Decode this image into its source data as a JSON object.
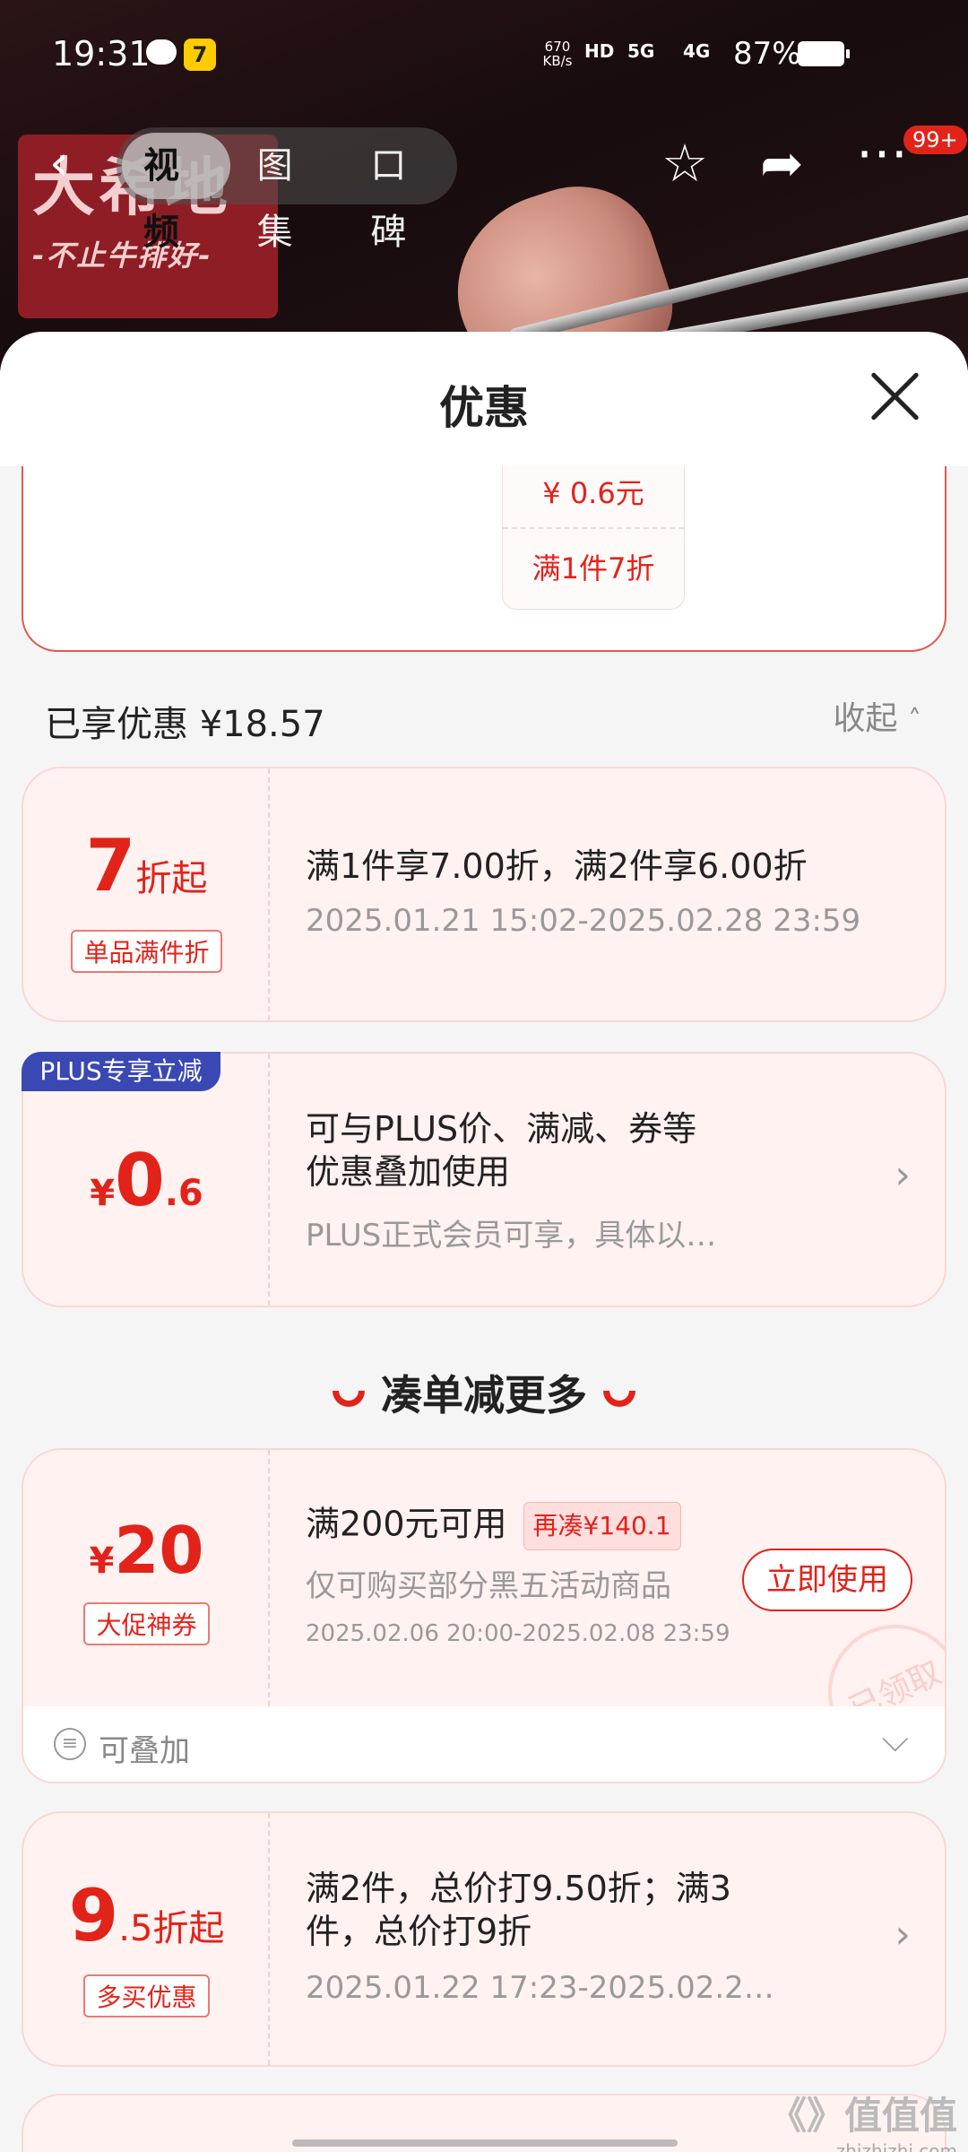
{
  "status_bar": {
    "time": "19:31",
    "app_badge": "7",
    "net_speed": "670",
    "net_unit": "KB/s",
    "hd": "HD",
    "sig1": "5G",
    "sig2": "4G",
    "battery": "87%"
  },
  "nav": {
    "tabs": [
      "视频",
      "图集",
      "口碑"
    ],
    "active_tab": "视频",
    "badge": "99+"
  },
  "background": {
    "logo_big": "大希地",
    "logo_small": "-不止牛排好-"
  },
  "sheet": {
    "title": "优惠",
    "top_card": {
      "price": "¥ 0.6元",
      "rule": "满1件7折"
    },
    "summary": "已享优惠 ¥18.57",
    "collapse_label": "收起"
  },
  "coupons": [
    {
      "value_main": "7",
      "value_suffix": "折起",
      "tag": "单品满件折",
      "title": "满1件享7.00折，满2件享6.00折",
      "sub": "2025.01.21 15:02-2025.02.28 23:59"
    },
    {
      "corner_tag": "PLUS专享立减",
      "value_prefix": "¥",
      "value_main": "0",
      "value_suffix": ".6",
      "title_line1": "可与PLUS价、满减、券等",
      "title_line2": "优惠叠加使用",
      "sub": "PLUS正式会员可享，具体以…"
    }
  ],
  "section_title": "凑单减更多",
  "deal_coupon": {
    "value_prefix": "¥",
    "value_main": "20",
    "tag": "大促神券",
    "title": "满200元可用",
    "again": "再凑¥140.1",
    "desc": "仅可购买部分黑五活动商品",
    "time": "2025.02.06 20:00-2025.02.08 23:59",
    "button": "立即使用",
    "stamp": "已领取",
    "stack_label": "可叠加"
  },
  "multi_coupon": {
    "value_main": "9",
    "value_suffix": ".5折起",
    "tag": "多买优惠",
    "title_line1": "满2件，总价打9.50折；满3",
    "title_line2": "件，总价打9折",
    "sub": "2025.01.22 17:23-2025.02.2…"
  },
  "watermark": {
    "brand": "《》值值值",
    "site": "zhizhizhi.com"
  }
}
